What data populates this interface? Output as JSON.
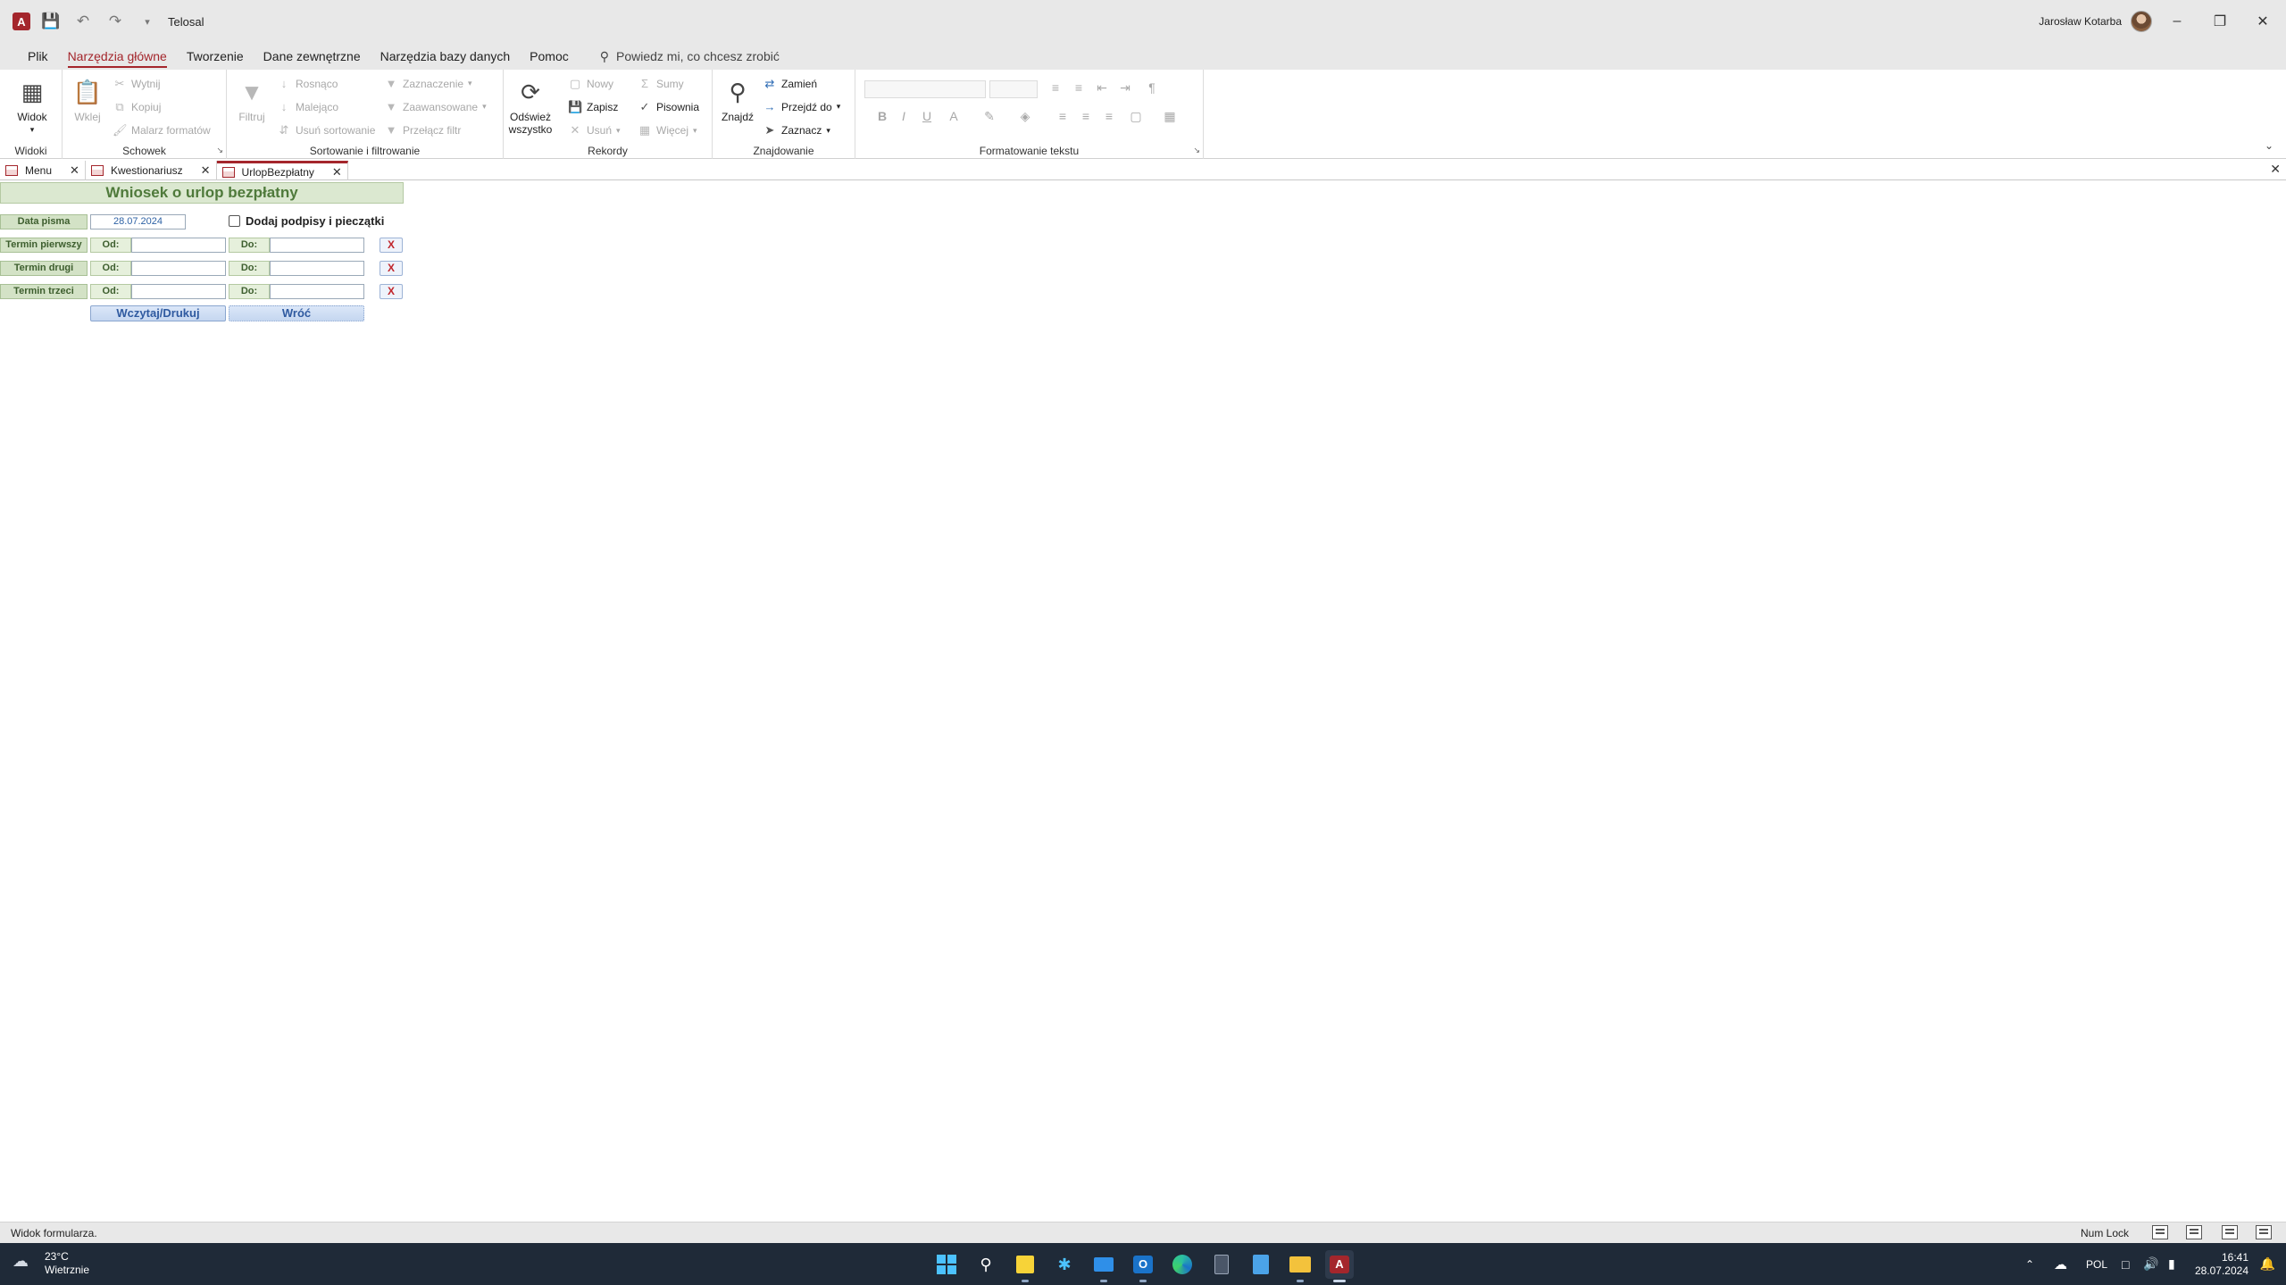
{
  "titlebar": {
    "title": "Telosal",
    "user": "Jarosław Kotarba"
  },
  "menu": {
    "tabs": [
      "Plik",
      "Narzędzia główne",
      "Tworzenie",
      "Dane zewnętrzne",
      "Narzędzia bazy danych",
      "Pomoc"
    ],
    "tellme": "Powiedz mi, co chcesz zrobić"
  },
  "ribbon": {
    "widoki": {
      "label": "Widoki",
      "widok": "Widok"
    },
    "schowek": {
      "label": "Schowek",
      "wklej": "Wklej",
      "wytnij": "Wytnij",
      "kopiuj": "Kopiuj",
      "malarz": "Malarz formatów"
    },
    "sort": {
      "label": "Sortowanie i filtrowanie",
      "filtruj": "Filtruj",
      "rosnaco": "Rosnąco",
      "malejaco": "Malejąco",
      "usun_sort": "Usuń sortowanie",
      "zaznaczenie": "Zaznaczenie",
      "zaawansowane": "Zaawansowane",
      "przelacz": "Przełącz filtr"
    },
    "rekordy": {
      "label": "Rekordy",
      "odswiez1": "Odśwież",
      "odswiez2": "wszystko",
      "nowy": "Nowy",
      "zapisz": "Zapisz",
      "usun": "Usuń",
      "sumy": "Sumy",
      "pisownia": "Pisownia",
      "wiecej": "Więcej"
    },
    "znajdowanie": {
      "label": "Znajdowanie",
      "znajdz": "Znajdź",
      "zamien": "Zamień",
      "przejdz": "Przejdź do",
      "zaznacz": "Zaznacz"
    },
    "formatowanie": {
      "label": "Formatowanie tekstu"
    }
  },
  "doctabs": [
    "Menu",
    "Kwestionariusz",
    "UrlopBezpłatny"
  ],
  "form": {
    "title": "Wniosek o urlop bezpłatny",
    "data_pisma_label": "Data pisma",
    "data_pisma_value": "28.07.2024",
    "checkbox_label": "Dodaj podpisy i pieczątki",
    "terms": [
      {
        "label": "Termin pierwszy",
        "od": "Od:",
        "do": "Do:",
        "od_value": "",
        "do_value": "",
        "clear": "X"
      },
      {
        "label": "Termin drugi",
        "od": "Od:",
        "do": "Do:",
        "od_value": "",
        "do_value": "",
        "clear": "X"
      },
      {
        "label": "Termin trzeci",
        "od": "Od:",
        "do": "Do:",
        "od_value": "",
        "do_value": "",
        "clear": "X"
      }
    ],
    "load_print": "Wczytaj/Drukuj",
    "back": "Wróć"
  },
  "statusbar": {
    "left": "Widok formularza.",
    "numlock": "Num Lock"
  },
  "taskbar": {
    "temp": "23°C",
    "weather": "Wietrznie",
    "lang": "POL",
    "time": "16:41",
    "date": "28.07.2024"
  },
  "colors": {
    "accent": "#a4262c",
    "form_label_bg": "#d3e2c6",
    "form_label_text": "#3d5e2e",
    "button_text": "#2f5aa0",
    "taskbar_bg": "#1f2a38"
  }
}
